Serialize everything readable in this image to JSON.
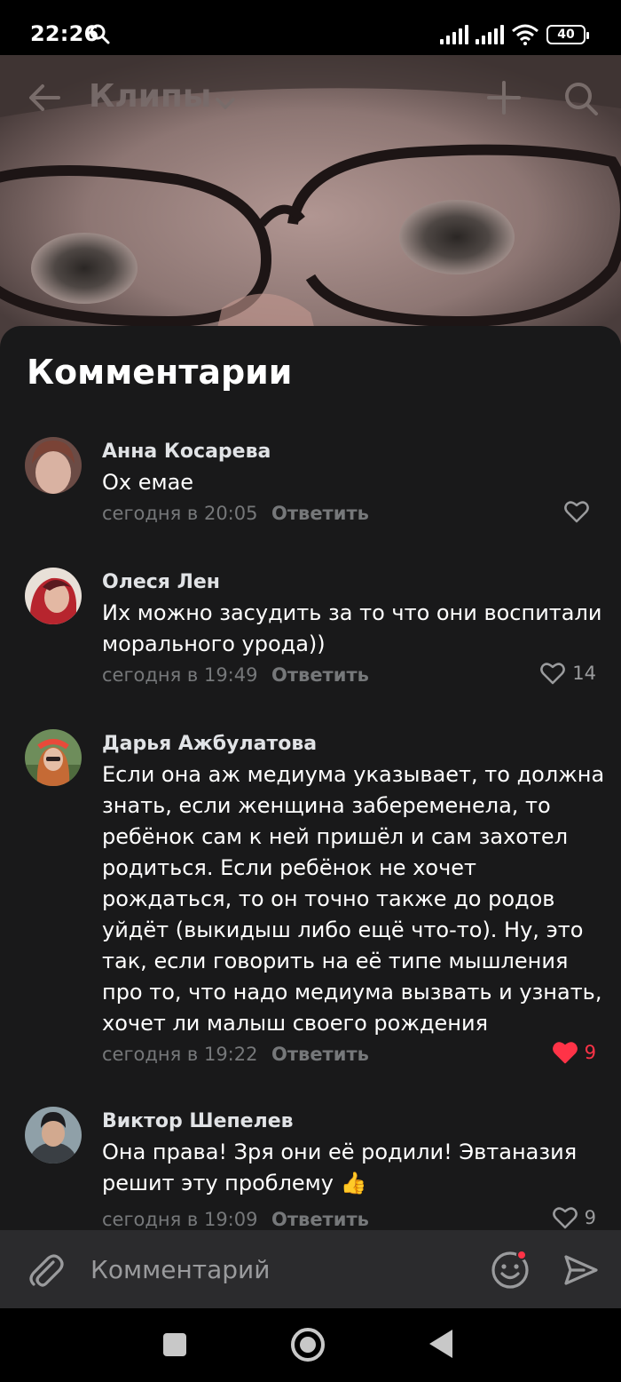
{
  "status_bar": {
    "time": "22:26",
    "battery": "40",
    "icons": [
      "search-icon",
      "signal-icon",
      "signal-icon",
      "wifi-icon",
      "battery-icon"
    ]
  },
  "header": {
    "title": "Клипы",
    "icons": [
      "back-arrow-icon",
      "chevron-down-icon",
      "plus-icon",
      "search-icon"
    ]
  },
  "comments_sheet": {
    "title": "Комментарии",
    "reply_label": "Ответить",
    "comments": [
      {
        "author": "Анна Косарева",
        "text": "Ох емае",
        "time": "сегодня в 20:05",
        "likes": "",
        "liked": false
      },
      {
        "author": "Олеся Лен",
        "text": "Их можно засудить за то что они воспитали морального урода))",
        "time": "сегодня в 19:49",
        "likes": "14",
        "liked": false
      },
      {
        "author": "Дарья Ажбулатова",
        "text": "Если она аж медиума указывает, то должна знать, если женщина забеременела, то ребёнок сам к ней пришёл и сам захотел родиться. Если ребёнок не хочет рождаться, то он точно также до родов уйдёт (выкидыш либо ещё что-то). Ну, это так, если говорить на её типе мышления про то, что надо медиума вызвать и узнать, хочет ли малыш своего рождения",
        "time": "сегодня в 19:22",
        "likes": "9",
        "liked": true
      },
      {
        "author": "Виктор Шепелев",
        "text": "Она права! Зря они её родили! Эвтаназия решит эту проблему 👍",
        "time": "сегодня в 19:09",
        "likes": "9",
        "liked": false
      }
    ]
  },
  "composer": {
    "placeholder": "Комментарий",
    "icons": [
      "paperclip-icon",
      "emoji-icon",
      "send-icon"
    ]
  },
  "nav_bar": {
    "icons": [
      "recents-square-icon",
      "home-circle-icon",
      "back-triangle-icon"
    ]
  },
  "colors": {
    "sheet_bg": "#19191a",
    "composer_bg": "#2b2b2d",
    "like_red": "#ff3347",
    "meta_gray": "#76787a"
  }
}
